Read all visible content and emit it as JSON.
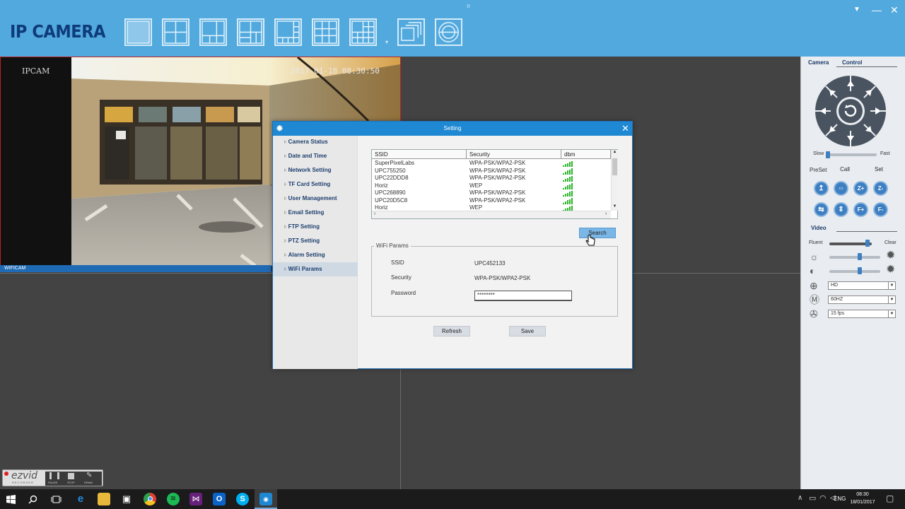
{
  "app": {
    "logo": "IP CAMERA",
    "drag_handle": "ıı"
  },
  "toolbar": {
    "layout_buttons": [
      "single-view",
      "four-view",
      "six-view",
      "eight-view",
      "eight-view-alt",
      "nine-view",
      "sixteen-view",
      "fullscreen",
      "cycle"
    ],
    "dropdown_arrow": "▾"
  },
  "window_controls": {
    "menu": "▼",
    "minimize": "—",
    "close": "✕"
  },
  "video": {
    "overlay_name": "IPCAM",
    "timestamp": "2017-01-18 08:30:50",
    "feed_label": "WIFICAM"
  },
  "dialog": {
    "title": "Setting",
    "close": "✕",
    "menu": [
      {
        "label": "Camera Status"
      },
      {
        "label": "Date and Time"
      },
      {
        "label": "Network Setting"
      },
      {
        "label": "TF Card Setting"
      },
      {
        "label": "User Management"
      },
      {
        "label": "Email Setting"
      },
      {
        "label": "FTP Setting"
      },
      {
        "label": "PTZ Setting"
      },
      {
        "label": "Alarm Setting"
      },
      {
        "label": "WiFi Params"
      }
    ],
    "active_menu": "WiFi Params",
    "table": {
      "columns": [
        "SSID",
        "Security",
        "dbm"
      ],
      "rows": [
        {
          "ssid": "SuperPixelLabs",
          "security": "WPA-PSK/WPA2-PSK",
          "signal": 5
        },
        {
          "ssid": "UPC755250",
          "security": "WPA-PSK/WPA2-PSK",
          "signal": 5
        },
        {
          "ssid": "UPC22DDD8",
          "security": "WPA-PSK/WPA2-PSK",
          "signal": 5
        },
        {
          "ssid": "Horiz",
          "security": "WEP",
          "signal": 5
        },
        {
          "ssid": "UPC268890",
          "security": "WPA-PSK/WPA2-PSK",
          "signal": 5
        },
        {
          "ssid": "UPC20D5C8",
          "security": "WPA-PSK/WPA2-PSK",
          "signal": 5
        },
        {
          "ssid": "Horiz",
          "security": "WEP",
          "signal": 5
        }
      ]
    },
    "search_button": "Search",
    "wifi_params": {
      "legend": "WiFi Params",
      "ssid_label": "SSID",
      "ssid_value": "UPC452133",
      "security_label": "Security",
      "security_value": "WPA-PSK/WPA2-PSK",
      "password_label": "Password",
      "password_value": "********"
    },
    "refresh_button": "Refresh",
    "save_button": "Save"
  },
  "right_panel": {
    "tabs": [
      "Camera",
      "Control"
    ],
    "speed": {
      "slow": "Slow",
      "fast": "Fast",
      "level": 0.02
    },
    "preset": {
      "label": "PreSet",
      "call": "Call",
      "set": "Set"
    },
    "ptz_buttons_row1": [
      "↥",
      "⇔",
      "Z+",
      "Z-"
    ],
    "ptz_buttons_row2": [
      "⇆",
      "⇕",
      "F+",
      "F-"
    ],
    "video_tab": "Video",
    "quality": {
      "fluent": "Fluent",
      "clear": "Clear",
      "level": 0.9
    },
    "brightness_level": 0.6,
    "contrast_level": 0.6,
    "resolution": "HD",
    "frequency": "60HZ",
    "fps": "15 fps"
  },
  "recorder": {
    "brand": "ezvid",
    "sub": "RECORDER",
    "pause": "PAUSE",
    "stop": "STOP",
    "draw": "DRAW"
  },
  "taskbar": {
    "language": "ENG",
    "time": "08:30",
    "date": "18/01/2017",
    "tray_up": "∧"
  },
  "colors": {
    "accent": "#52a9de",
    "dialog_title": "#1f88d2",
    "signal": "#2bb42b"
  }
}
